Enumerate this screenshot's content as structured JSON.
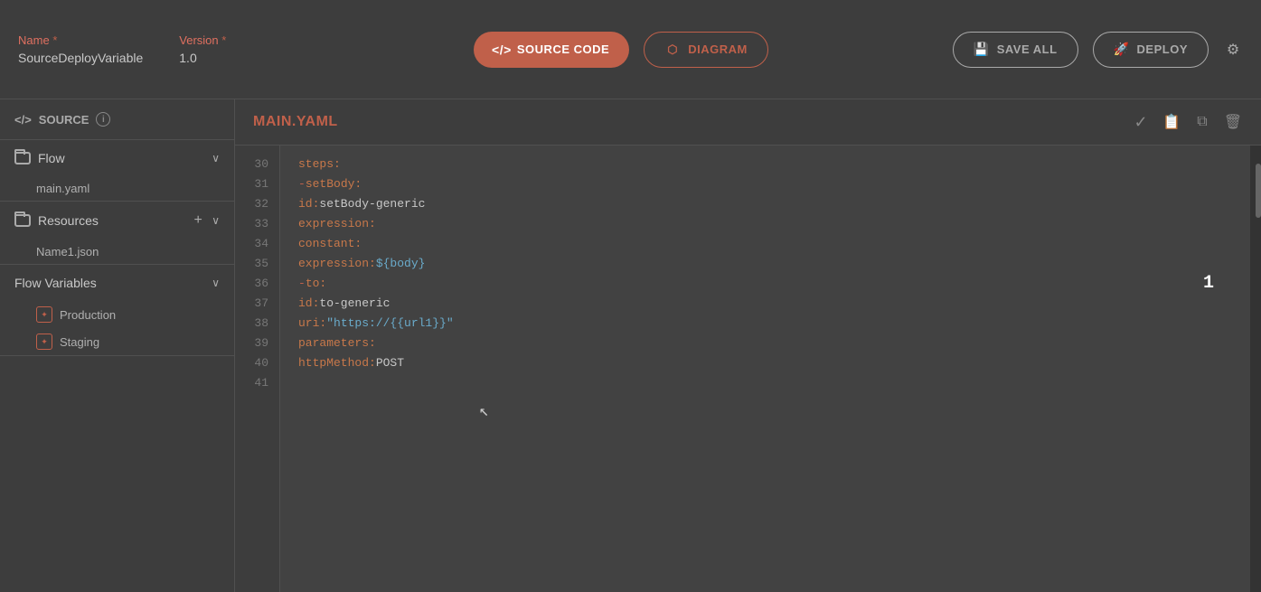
{
  "header": {
    "name_label": "Name",
    "name_required": "*",
    "name_value": "SourceDeployVariable",
    "version_label": "Version",
    "version_required": "*",
    "version_value": "1.0",
    "source_code_btn": "SOURCE CODE",
    "diagram_btn": "DIAGRAM",
    "save_all_btn": "SAVE ALL",
    "deploy_btn": "DEPLOY"
  },
  "sidebar": {
    "source_label": "SOURCE",
    "flow_label": "Flow",
    "flow_file": "main.yaml",
    "resources_label": "Resources",
    "resources_file": "Name1.json",
    "flow_variables_label": "Flow Variables",
    "var1_label": "Production",
    "var2_label": "Staging"
  },
  "editor": {
    "file_title": "MAIN.YAML",
    "lines": [
      {
        "num": 30,
        "content": "steps:"
      },
      {
        "num": 31,
        "content": "  - setBody:"
      },
      {
        "num": 32,
        "content": "      id: setBody-generic"
      },
      {
        "num": 33,
        "content": "      expression:"
      },
      {
        "num": 34,
        "content": "        constant:"
      },
      {
        "num": 35,
        "content": "          expression: ${body}"
      },
      {
        "num": 36,
        "content": "  - to:"
      },
      {
        "num": 37,
        "content": "      id: to-generic"
      },
      {
        "num": 38,
        "content": "      uri: \"https://{{url1}}\""
      },
      {
        "num": 39,
        "content": "      parameters:"
      },
      {
        "num": 40,
        "content": "        httpMethod: POST"
      },
      {
        "num": 41,
        "content": ""
      }
    ]
  },
  "colors": {
    "accent": "#c0604a",
    "bg_dark": "#3d3d3d",
    "bg_mid": "#424242",
    "text_primary": "#c8c8c8",
    "text_muted": "#aaaaaa",
    "code_key": "#c8784a",
    "code_str": "#6aabcb"
  }
}
